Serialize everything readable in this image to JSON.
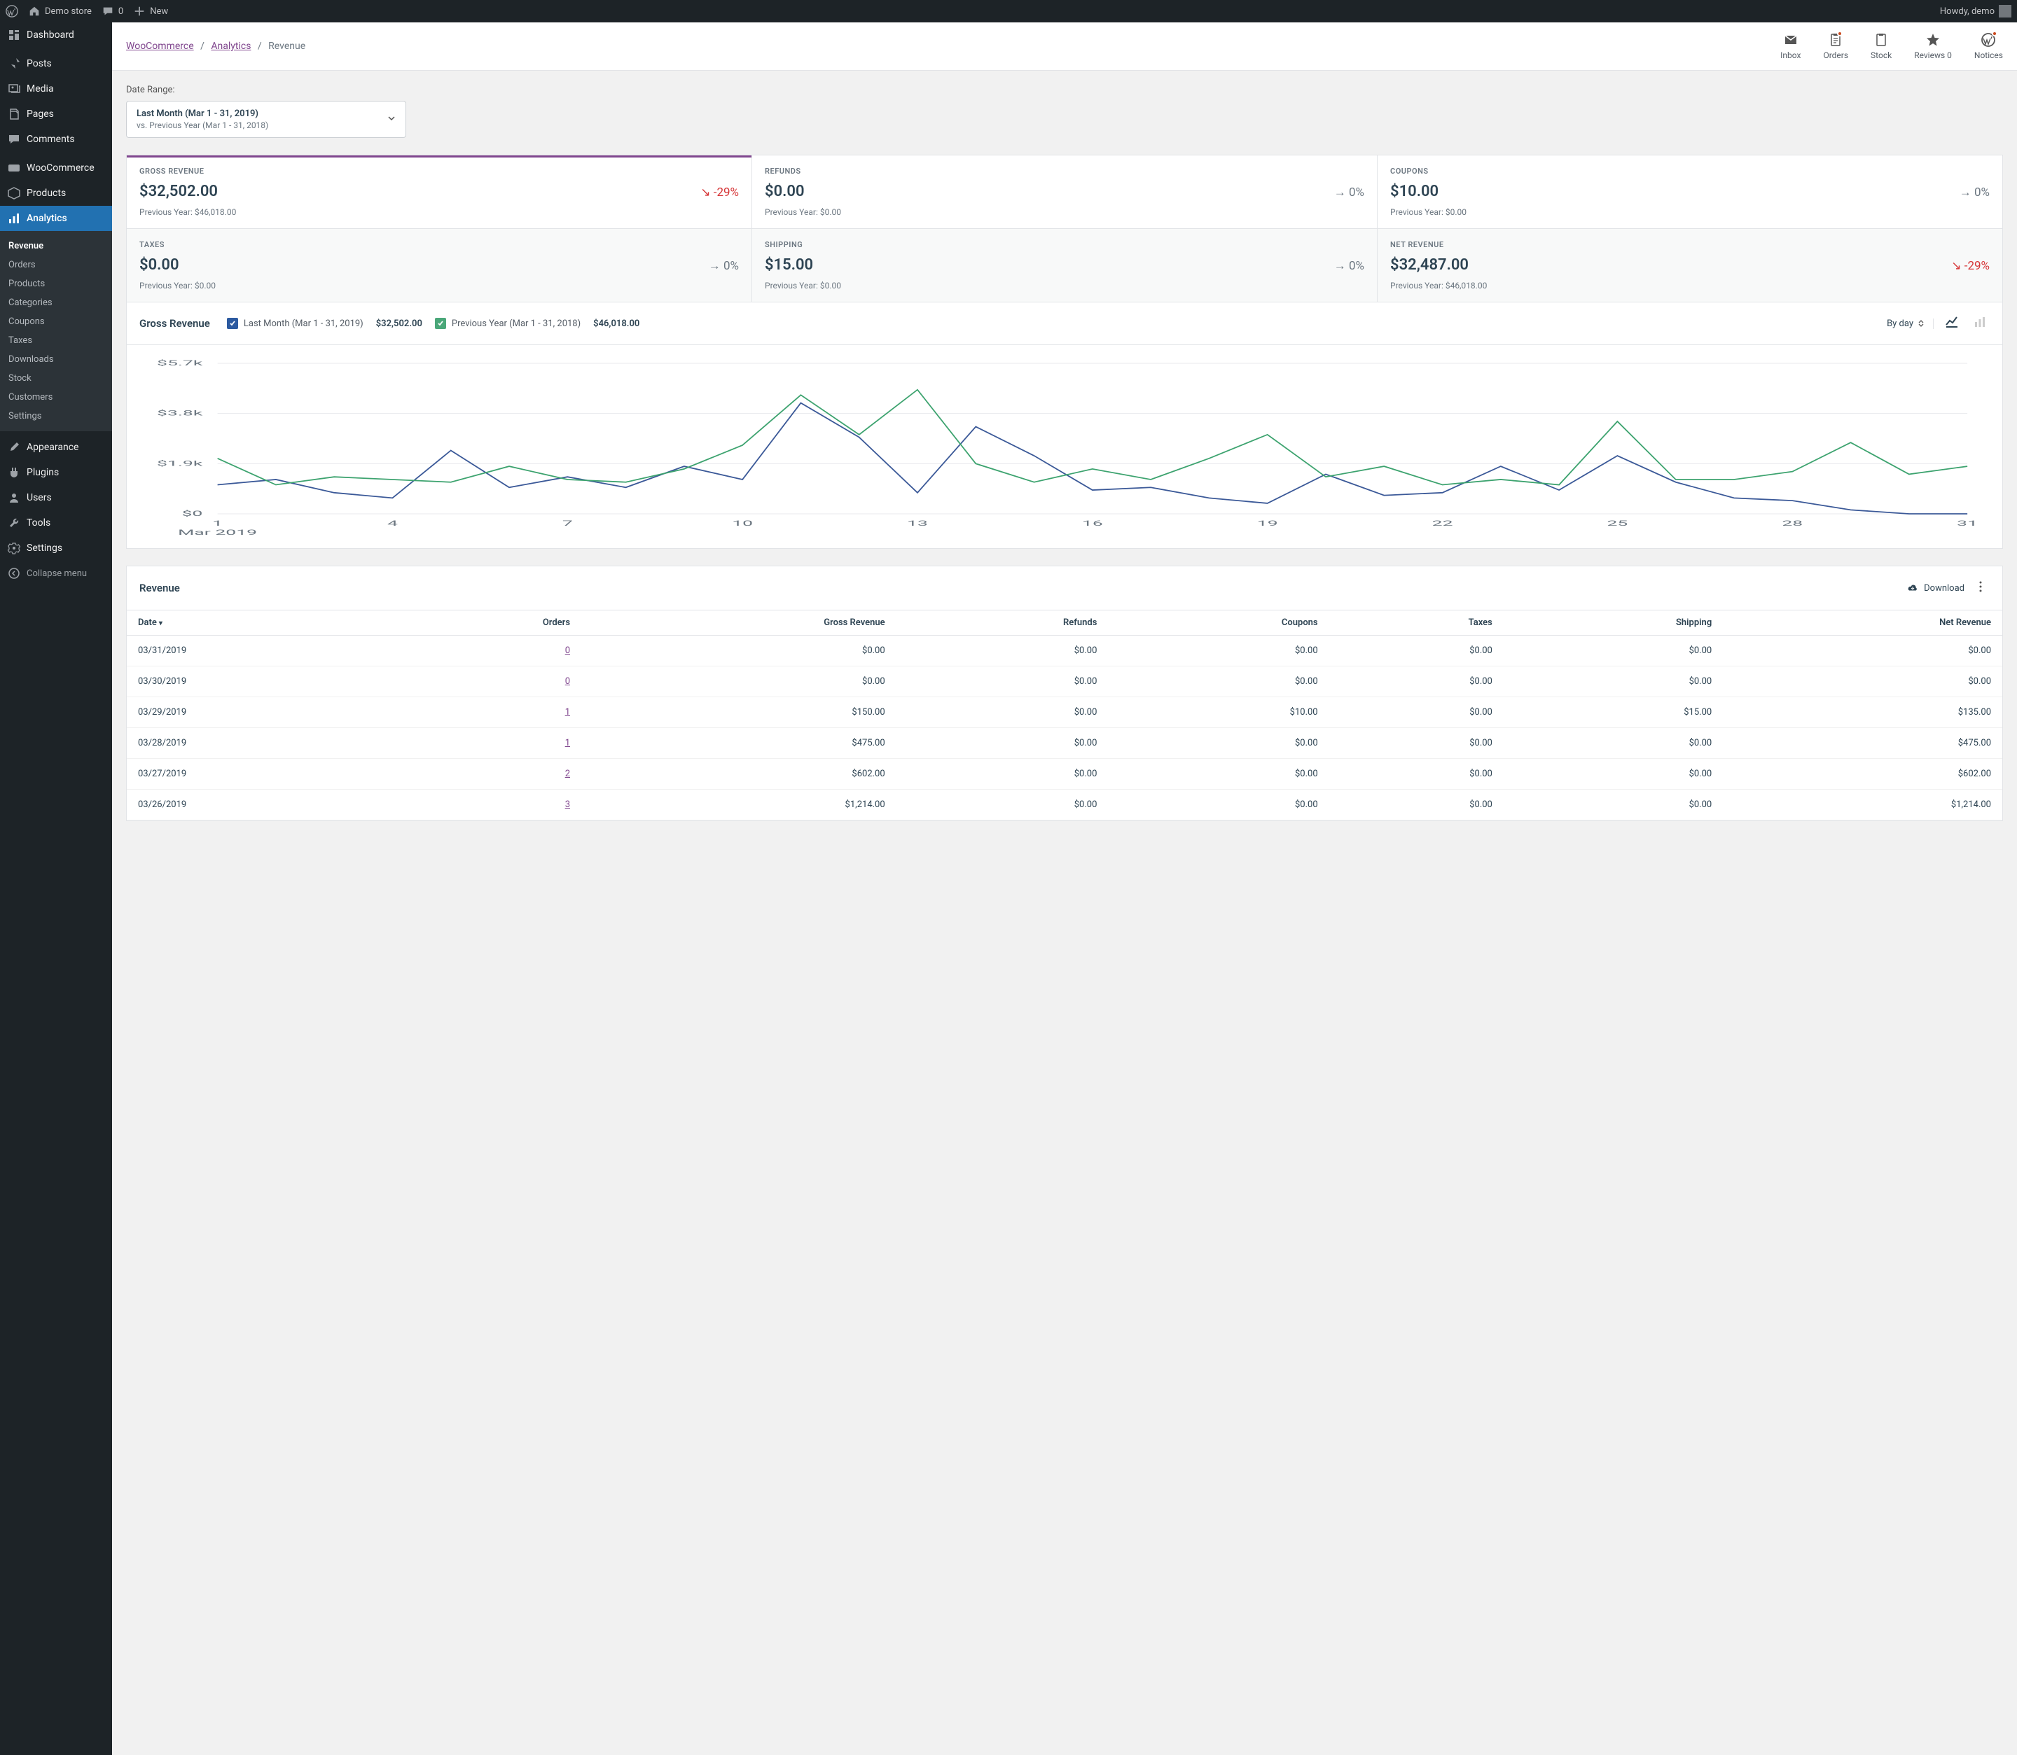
{
  "adminBar": {
    "siteName": "Demo store",
    "commentCount": "0",
    "newLabel": "New",
    "howdy": "Howdy, demo"
  },
  "sidebar": {
    "items": [
      {
        "label": "Dashboard",
        "icon": "dashboard"
      },
      {
        "label": "Posts",
        "icon": "pin"
      },
      {
        "label": "Media",
        "icon": "media"
      },
      {
        "label": "Pages",
        "icon": "pages"
      },
      {
        "label": "Comments",
        "icon": "comment"
      },
      {
        "label": "WooCommerce",
        "icon": "woo"
      },
      {
        "label": "Products",
        "icon": "product"
      },
      {
        "label": "Analytics",
        "icon": "analytics",
        "current": true
      },
      {
        "label": "Appearance",
        "icon": "brush"
      },
      {
        "label": "Plugins",
        "icon": "plugin"
      },
      {
        "label": "Users",
        "icon": "users"
      },
      {
        "label": "Tools",
        "icon": "tools"
      },
      {
        "label": "Settings",
        "icon": "settings"
      }
    ],
    "submenu": [
      "Revenue",
      "Orders",
      "Products",
      "Categories",
      "Coupons",
      "Taxes",
      "Downloads",
      "Stock",
      "Customers",
      "Settings"
    ],
    "collapse": "Collapse menu"
  },
  "breadcrumb": {
    "a": "WooCommerce",
    "b": "Analytics",
    "c": "Revenue"
  },
  "topActions": [
    {
      "label": "Inbox",
      "icon": "mail"
    },
    {
      "label": "Orders",
      "icon": "clipboard",
      "dot": true
    },
    {
      "label": "Stock",
      "icon": "clipboard2"
    },
    {
      "label": "Reviews 0",
      "icon": "star"
    },
    {
      "label": "Notices",
      "icon": "wp",
      "dot": true
    }
  ],
  "dateRange": {
    "label": "Date Range:",
    "primary": "Last Month (Mar 1 - 31, 2019)",
    "secondary": "vs. Previous Year (Mar 1 - 31, 2018)"
  },
  "stats": [
    {
      "title": "GROSS REVENUE",
      "value": "$32,502.00",
      "delta": "-29%",
      "deltaDir": "down",
      "prev": "Previous Year: $46,018.00",
      "active": true
    },
    {
      "title": "REFUNDS",
      "value": "$0.00",
      "delta": "0%",
      "deltaDir": "flat",
      "prev": "Previous Year: $0.00"
    },
    {
      "title": "COUPONS",
      "value": "$10.00",
      "delta": "0%",
      "deltaDir": "flat",
      "prev": "Previous Year: $0.00"
    },
    {
      "title": "TAXES",
      "value": "$0.00",
      "delta": "0%",
      "deltaDir": "flat",
      "prev": "Previous Year: $0.00",
      "dim": true
    },
    {
      "title": "SHIPPING",
      "value": "$15.00",
      "delta": "0%",
      "deltaDir": "flat",
      "prev": "Previous Year: $0.00",
      "dim": true
    },
    {
      "title": "NET REVENUE",
      "value": "$32,487.00",
      "delta": "-29%",
      "deltaDir": "down",
      "prev": "Previous Year: $46,018.00",
      "dim": true
    }
  ],
  "chart": {
    "title": "Gross Revenue",
    "legendCurrent": "Last Month (Mar 1 - 31, 2019)",
    "legendCurrentValue": "$32,502.00",
    "legendPrev": "Previous Year (Mar 1 - 31, 2018)",
    "legendPrevValue": "$46,018.00",
    "interval": "By day",
    "monthLabel": "Mar 2019"
  },
  "chart_data": {
    "type": "line",
    "title": "Gross Revenue",
    "xlabel": "",
    "ylabel": "",
    "ylim": [
      0,
      5700
    ],
    "y_ticks": [
      "$0",
      "$1.9k",
      "$3.8k",
      "$5.7k"
    ],
    "x_ticks": [
      1,
      4,
      7,
      10,
      13,
      16,
      19,
      22,
      25,
      28,
      31
    ],
    "categories": [
      1,
      2,
      3,
      4,
      5,
      6,
      7,
      8,
      9,
      10,
      11,
      12,
      13,
      14,
      15,
      16,
      17,
      18,
      19,
      20,
      21,
      22,
      23,
      24,
      25,
      26,
      27,
      28,
      29,
      30,
      31
    ],
    "series": [
      {
        "name": "Last Month (Mar 1 - 31, 2019)",
        "color": "#3b5998",
        "values": [
          1100,
          1300,
          800,
          600,
          2400,
          1000,
          1400,
          1000,
          1800,
          1300,
          4200,
          2900,
          800,
          3300,
          2200,
          900,
          1000,
          600,
          400,
          1500,
          700,
          800,
          1800,
          900,
          2200,
          1200,
          600,
          500,
          150,
          0,
          0
        ]
      },
      {
        "name": "Previous Year (Mar 1 - 31, 2018)",
        "color": "#3da36f",
        "values": [
          2100,
          1100,
          1400,
          1300,
          1200,
          1800,
          1300,
          1200,
          1700,
          2600,
          4500,
          3000,
          4700,
          1900,
          1200,
          1700,
          1300,
          2100,
          3000,
          1400,
          1800,
          1100,
          1300,
          1100,
          3500,
          1300,
          1300,
          1600,
          2700,
          1500,
          1800
        ]
      }
    ]
  },
  "table": {
    "title": "Revenue",
    "download": "Download",
    "headers": [
      "Date",
      "Orders",
      "Gross Revenue",
      "Refunds",
      "Coupons",
      "Taxes",
      "Shipping",
      "Net Revenue"
    ],
    "rows": [
      {
        "date": "03/31/2019",
        "orders": "0",
        "gross": "$0.00",
        "refunds": "$0.00",
        "coupons": "$0.00",
        "taxes": "$0.00",
        "shipping": "$0.00",
        "net": "$0.00"
      },
      {
        "date": "03/30/2019",
        "orders": "0",
        "gross": "$0.00",
        "refunds": "$0.00",
        "coupons": "$0.00",
        "taxes": "$0.00",
        "shipping": "$0.00",
        "net": "$0.00"
      },
      {
        "date": "03/29/2019",
        "orders": "1",
        "gross": "$150.00",
        "refunds": "$0.00",
        "coupons": "$10.00",
        "taxes": "$0.00",
        "shipping": "$15.00",
        "net": "$135.00"
      },
      {
        "date": "03/28/2019",
        "orders": "1",
        "gross": "$475.00",
        "refunds": "$0.00",
        "coupons": "$0.00",
        "taxes": "$0.00",
        "shipping": "$0.00",
        "net": "$475.00"
      },
      {
        "date": "03/27/2019",
        "orders": "2",
        "gross": "$602.00",
        "refunds": "$0.00",
        "coupons": "$0.00",
        "taxes": "$0.00",
        "shipping": "$0.00",
        "net": "$602.00"
      },
      {
        "date": "03/26/2019",
        "orders": "3",
        "gross": "$1,214.00",
        "refunds": "$0.00",
        "coupons": "$0.00",
        "taxes": "$0.00",
        "shipping": "$0.00",
        "net": "$1,214.00"
      }
    ]
  }
}
